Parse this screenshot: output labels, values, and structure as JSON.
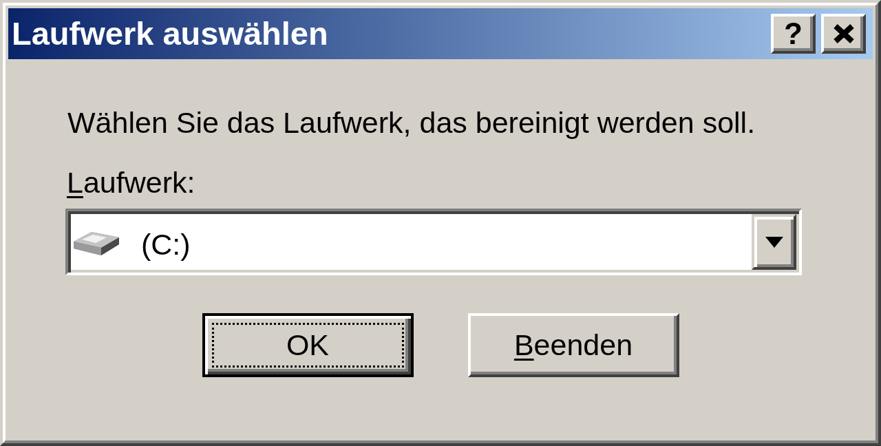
{
  "window": {
    "title": "Laufwerk auswählen",
    "title_buttons": [
      {
        "kind": "help",
        "label": "?"
      },
      {
        "kind": "close"
      }
    ]
  },
  "prompt": "Wählen Sie das Laufwerk, das bereinigt werden soll.",
  "drive_field": {
    "label": "Laufwerk:",
    "label_mnemonic_underlined": true,
    "value": "(C:)"
  },
  "buttons": [
    {
      "label": "OK",
      "default": true,
      "focused": true,
      "mnemonic_underlined": false
    },
    {
      "label": "Beenden",
      "default": false,
      "focused": false,
      "mnemonic_underlined": true
    }
  ]
}
